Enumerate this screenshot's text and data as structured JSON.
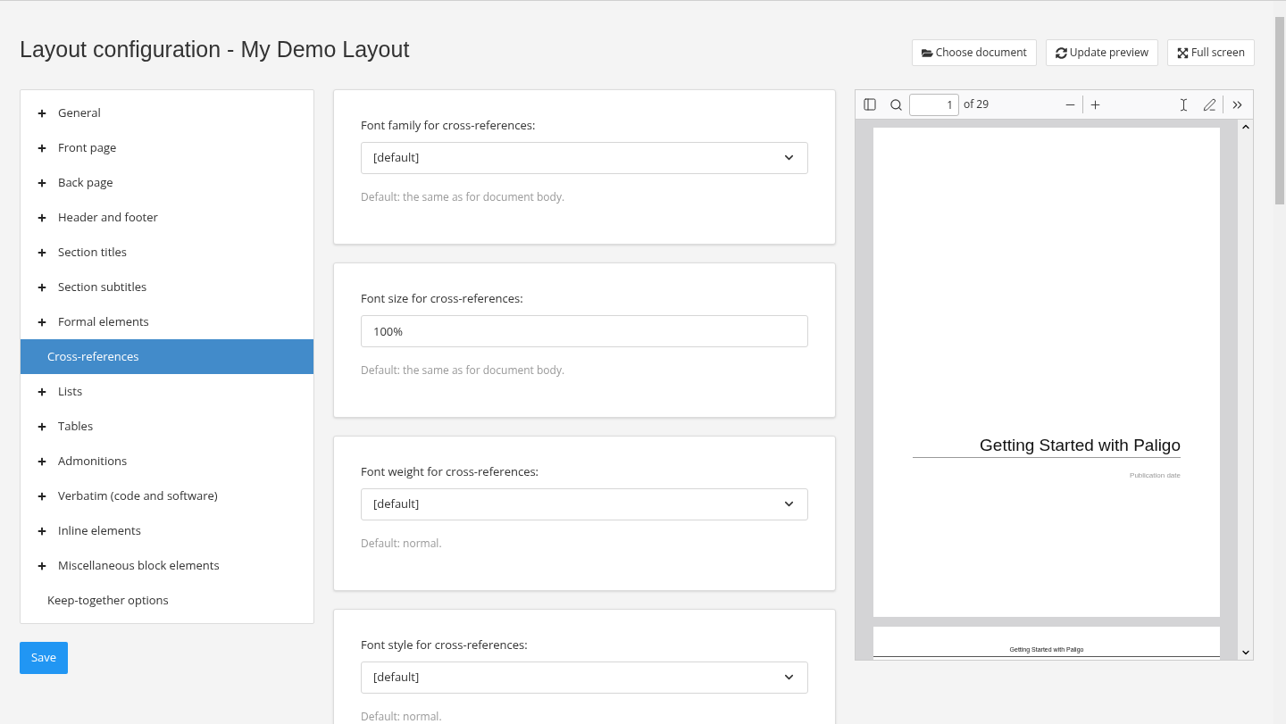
{
  "title": "Layout configuration - My Demo Layout",
  "actions": [
    {
      "kind": "folder",
      "label": "Choose document"
    },
    {
      "kind": "refresh",
      "label": "Update preview"
    },
    {
      "kind": "expand",
      "label": "Full screen"
    }
  ],
  "sidebar": {
    "items": [
      {
        "label": "General",
        "expandable": true,
        "selected": false
      },
      {
        "label": "Front page",
        "expandable": true,
        "selected": false
      },
      {
        "label": "Back page",
        "expandable": true,
        "selected": false
      },
      {
        "label": "Header and footer",
        "expandable": true,
        "selected": false
      },
      {
        "label": "Section titles",
        "expandable": true,
        "selected": false
      },
      {
        "label": "Section subtitles",
        "expandable": true,
        "selected": false
      },
      {
        "label": "Formal elements",
        "expandable": true,
        "selected": false
      },
      {
        "label": "Cross-references",
        "expandable": false,
        "selected": true
      },
      {
        "label": "Lists",
        "expandable": true,
        "selected": false
      },
      {
        "label": "Tables",
        "expandable": true,
        "selected": false
      },
      {
        "label": "Admonitions",
        "expandable": true,
        "selected": false
      },
      {
        "label": "Verbatim (code and software)",
        "expandable": true,
        "selected": false
      },
      {
        "label": "Inline elements",
        "expandable": true,
        "selected": false
      },
      {
        "label": "Miscellaneous block elements",
        "expandable": true,
        "selected": false
      },
      {
        "label": "Keep-together options",
        "expandable": false,
        "selected": false
      }
    ]
  },
  "save_button": "Save",
  "settings": [
    {
      "kind": "select",
      "label": "Font family for cross-references:",
      "value": "[default]",
      "hint": "Default: the same as for document body."
    },
    {
      "kind": "text",
      "label": "Font size for cross-references:",
      "value": "100%",
      "hint": "Default: the same as for document body."
    },
    {
      "kind": "select",
      "label": "Font weight for cross-references:",
      "value": "[default]",
      "hint": "Default: normal."
    },
    {
      "kind": "select",
      "label": "Font style for cross-references:",
      "value": "[default]",
      "hint": "Default: normal."
    }
  ],
  "preview": {
    "page_number": "1",
    "page_count": "of 29",
    "page_title": "Getting Started with Paligo",
    "publication_date": "Publication date",
    "next_page_header": "Getting Started with Paligo"
  }
}
